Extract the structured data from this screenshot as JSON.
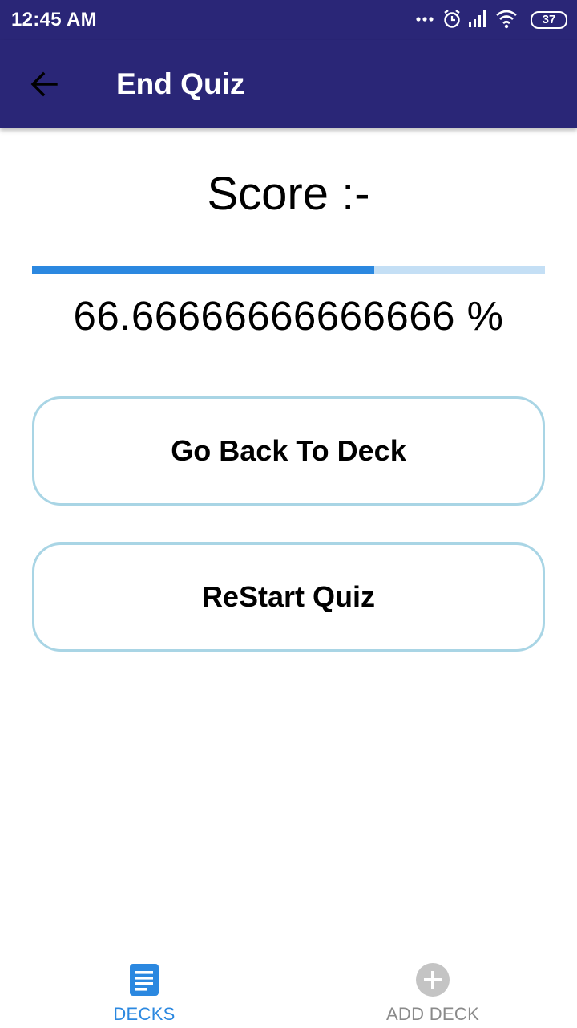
{
  "status_bar": {
    "time": "12:45 AM",
    "battery": "37",
    "icons": [
      "more-dots-icon",
      "alarm-icon",
      "signal-icon",
      "wifi-icon",
      "battery-icon"
    ]
  },
  "app_bar": {
    "title": "End Quiz",
    "back_icon": "arrow-left-icon",
    "background": "#2a2677"
  },
  "main": {
    "score_label": "Score :-",
    "score_value": "66.66666666666666 %",
    "progress_fraction": 0.6667,
    "progress_color": "#2b88e0",
    "progress_track_color": "#c4dff5"
  },
  "actions": {
    "go_back_label": "Go Back To Deck",
    "restart_label": "ReStart Quiz",
    "border_color": "#a9d5e5"
  },
  "bottom_nav": {
    "tabs": [
      {
        "label": "DECKS",
        "icon": "deck-list-icon",
        "active": true,
        "color": "#2b88e0"
      },
      {
        "label": "ADD DECK",
        "icon": "add-circle-icon",
        "active": false,
        "color": "#8a8a8a"
      }
    ]
  }
}
